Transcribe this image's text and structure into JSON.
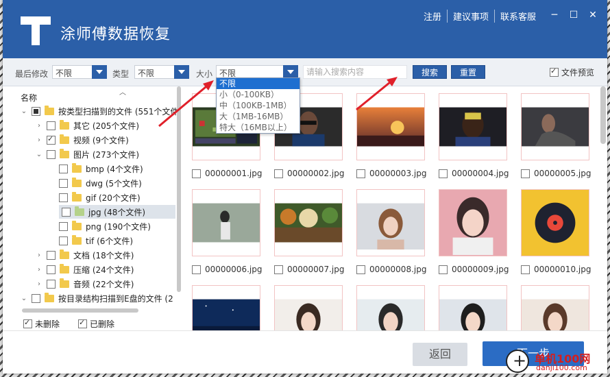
{
  "app": {
    "title": "涂师傅数据恢复"
  },
  "top_links": [
    "注册",
    "建议事项",
    "联系客服"
  ],
  "window_controls": [
    "─",
    "☐",
    "✕"
  ],
  "filters": {
    "last_modified": {
      "label": "最后修改",
      "value": "不限"
    },
    "type": {
      "label": "类型",
      "value": "不限"
    },
    "size": {
      "label": "大小",
      "value": "不限"
    },
    "search_placeholder": "请输入搜索内容",
    "search_button": "搜索",
    "reset_button": "重置",
    "preview_label": "文件预览"
  },
  "size_options": [
    "不限",
    "小（0-100KB）",
    "中（100KB-1MB）",
    "大（1MB-16MB）",
    "特大（16MB以上）"
  ],
  "tree": {
    "header": "名称",
    "nodes": [
      {
        "label": "按类型扫描到的文件 (551个文件)"
      },
      {
        "label": "其它 (205个文件)"
      },
      {
        "label": "视频 (9个文件)"
      },
      {
        "label": "图片 (273个文件)"
      },
      {
        "label": "bmp (4个文件)"
      },
      {
        "label": "dwg (5个文件)"
      },
      {
        "label": "gif (20个文件)"
      },
      {
        "label": "jpg (48个文件)"
      },
      {
        "label": "png (190个文件)"
      },
      {
        "label": "tif (6个文件)"
      },
      {
        "label": "文档 (18个文件)"
      },
      {
        "label": "压缩 (24个文件)"
      },
      {
        "label": "音频 (22个文件)"
      },
      {
        "label": "按目录结构扫描到E盘的文件 (2"
      }
    ],
    "undeleted_label": "未删除",
    "deleted_label": "已删除"
  },
  "files": [
    {
      "name": "00000001.jpg"
    },
    {
      "name": "00000002.jpg"
    },
    {
      "name": "00000003.jpg"
    },
    {
      "name": "00000004.jpg"
    },
    {
      "name": "00000005.jpg"
    },
    {
      "name": "00000006.jpg"
    },
    {
      "name": "00000007.jpg"
    },
    {
      "name": "00000008.jpg"
    },
    {
      "name": "00000009.jpg"
    },
    {
      "name": "00000010.jpg"
    },
    {
      "name": ""
    },
    {
      "name": ""
    },
    {
      "name": ""
    },
    {
      "name": ""
    },
    {
      "name": ""
    }
  ],
  "footer": {
    "back_label": "返回",
    "next_label": "下一步"
  },
  "watermark": {
    "text": "单机100网",
    "sub": "danji100.com"
  },
  "colors": {
    "brand": "#2b5fa8",
    "accent": "#1e6fd0",
    "arrow": "#e0202a"
  }
}
